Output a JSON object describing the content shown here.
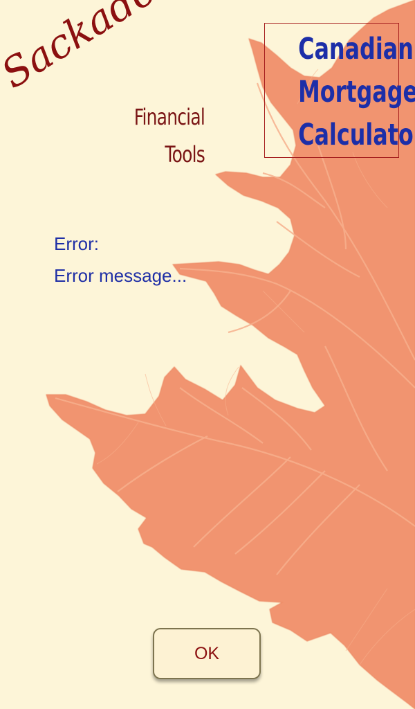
{
  "branding": {
    "name": "Sackadoo!",
    "tagline_line1": "Financial",
    "tagline_line2": "Tools"
  },
  "app_title": {
    "line1": "Canadian",
    "line2": "Mortgage",
    "line3": "Calculator"
  },
  "error": {
    "label": "Error:",
    "message": "Error message..."
  },
  "actions": {
    "ok_label": "OK"
  },
  "colors": {
    "background": "#fdf5d8",
    "leaf": "#f1946f",
    "brand_red": "#8b1010",
    "title_blue": "#1c2ea8",
    "error_blue": "#1f2fa6"
  },
  "decorations": {
    "background_image": "maple-leaf-icon"
  }
}
